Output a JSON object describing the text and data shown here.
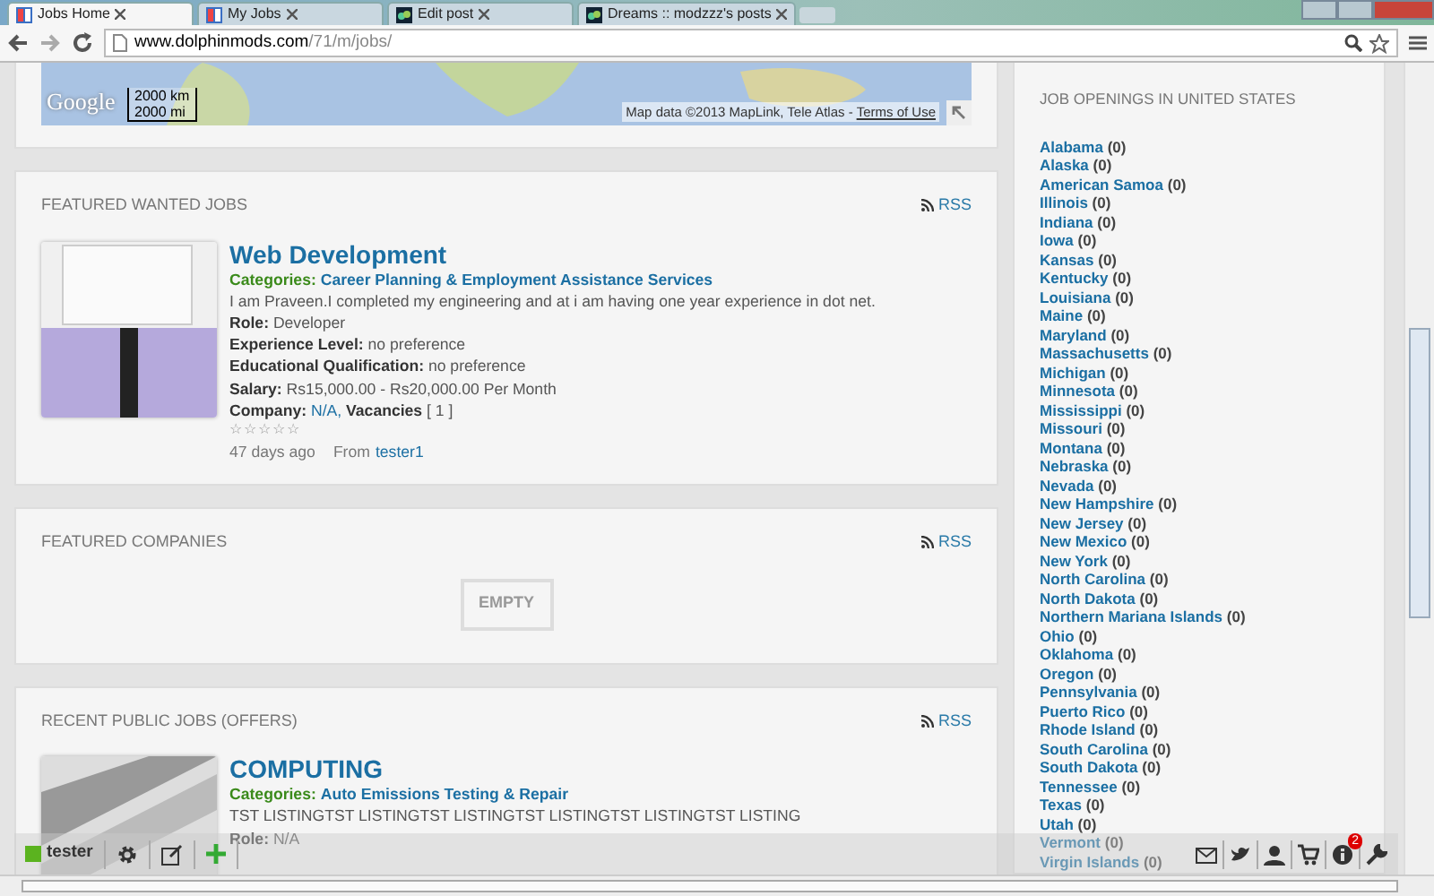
{
  "browser": {
    "tabs": [
      {
        "title": "Jobs Home",
        "selected": true
      },
      {
        "title": "My Jobs",
        "selected": false
      },
      {
        "title": "Edit post",
        "selected": false
      },
      {
        "title": "Dreams :: modzzz's posts",
        "selected": false
      }
    ],
    "url_host": "www.dolphinmods.com",
    "url_path": "/71/m/jobs/"
  },
  "map": {
    "logo": "Google",
    "scale": [
      "2000 km",
      "2000 mi"
    ],
    "attribution": "Map data ©2013 MapLink, Tele Atlas - ",
    "terms": "Terms of Use"
  },
  "sections": [
    {
      "title": "FEATURED WANTED JOBS",
      "rss": "RSS",
      "kind": "jobs",
      "jobs": [
        {
          "title": "Web Development",
          "category_label": "Categories:",
          "category": "Career Planning & Employment Assistance Services",
          "description": "I am Praveen.I completed my engineering and at i am having one year experience in dot net.",
          "fields": [
            {
              "label": "Role:",
              "value": "Developer"
            },
            {
              "label": "Experience Level:",
              "value": "no preference"
            },
            {
              "label": "Educational Qualification:",
              "value": "no preference"
            },
            {
              "label": "Salary:",
              "value": "Rs15,000.00 - Rs20,000.00 Per Month"
            }
          ],
          "company": {
            "label": "Company:",
            "value": "N/A,",
            "vacancies_label": "Vacancies",
            "vacancies": "[ 1 ]"
          },
          "stars": 0,
          "posted": "47 days ago",
          "from_label": "From",
          "author": "tester1"
        }
      ]
    },
    {
      "title": "FEATURED COMPANIES",
      "rss": "RSS",
      "kind": "empty",
      "empty_text": "EMPTY"
    },
    {
      "title": "RECENT PUBLIC JOBS (OFFERS)",
      "rss": "RSS",
      "kind": "jobs",
      "jobs": [
        {
          "title": "COMPUTING",
          "category_label": "Categories:",
          "category": "Auto Emissions Testing & Repair",
          "description": "TST LISTINGTST LISTINGTST LISTINGTST LISTINGTST LISTINGTST LISTING",
          "fields": [
            {
              "label": "Role:",
              "value": "N/A"
            }
          ]
        }
      ]
    }
  ],
  "sidebar": {
    "title": "JOB OPENINGS IN UNITED STATES",
    "states": [
      {
        "name": "Alabama",
        "count": "(0)"
      },
      {
        "name": "Alaska",
        "count": "(0)"
      },
      {
        "name": "American Samoa",
        "count": "(0)"
      },
      {
        "name": "Illinois",
        "count": "(0)"
      },
      {
        "name": "Indiana",
        "count": "(0)"
      },
      {
        "name": "Iowa",
        "count": "(0)"
      },
      {
        "name": "Kansas",
        "count": "(0)"
      },
      {
        "name": "Kentucky",
        "count": "(0)"
      },
      {
        "name": "Louisiana",
        "count": "(0)"
      },
      {
        "name": "Maine",
        "count": "(0)"
      },
      {
        "name": "Maryland",
        "count": "(0)"
      },
      {
        "name": "Massachusetts",
        "count": "(0)"
      },
      {
        "name": "Michigan",
        "count": "(0)"
      },
      {
        "name": "Minnesota",
        "count": "(0)"
      },
      {
        "name": "Mississippi",
        "count": "(0)"
      },
      {
        "name": "Missouri",
        "count": "(0)"
      },
      {
        "name": "Montana",
        "count": "(0)"
      },
      {
        "name": "Nebraska",
        "count": "(0)"
      },
      {
        "name": "Nevada",
        "count": "(0)"
      },
      {
        "name": "New Hampshire",
        "count": "(0)"
      },
      {
        "name": "New Jersey",
        "count": "(0)"
      },
      {
        "name": "New Mexico",
        "count": "(0)"
      },
      {
        "name": "New York",
        "count": "(0)"
      },
      {
        "name": "North Carolina",
        "count": "(0)"
      },
      {
        "name": "North Dakota",
        "count": "(0)"
      },
      {
        "name": "Northern Mariana Islands",
        "count": "(0)"
      },
      {
        "name": "Ohio",
        "count": "(0)"
      },
      {
        "name": "Oklahoma",
        "count": "(0)"
      },
      {
        "name": "Oregon",
        "count": "(0)"
      },
      {
        "name": "Pennsylvania",
        "count": "(0)"
      },
      {
        "name": "Puerto Rico",
        "count": "(0)"
      },
      {
        "name": "Rhode Island",
        "count": "(0)"
      },
      {
        "name": "South Carolina",
        "count": "(0)"
      },
      {
        "name": "South Dakota",
        "count": "(0)"
      },
      {
        "name": "Tennessee",
        "count": "(0)"
      },
      {
        "name": "Texas",
        "count": "(0)"
      },
      {
        "name": "Utah",
        "count": "(0)"
      },
      {
        "name": "Vermont",
        "count": "(0)"
      },
      {
        "name": "Virgin Islands",
        "count": "(0)"
      }
    ]
  },
  "toolbar": {
    "user": "tester",
    "notification_count": "2"
  }
}
